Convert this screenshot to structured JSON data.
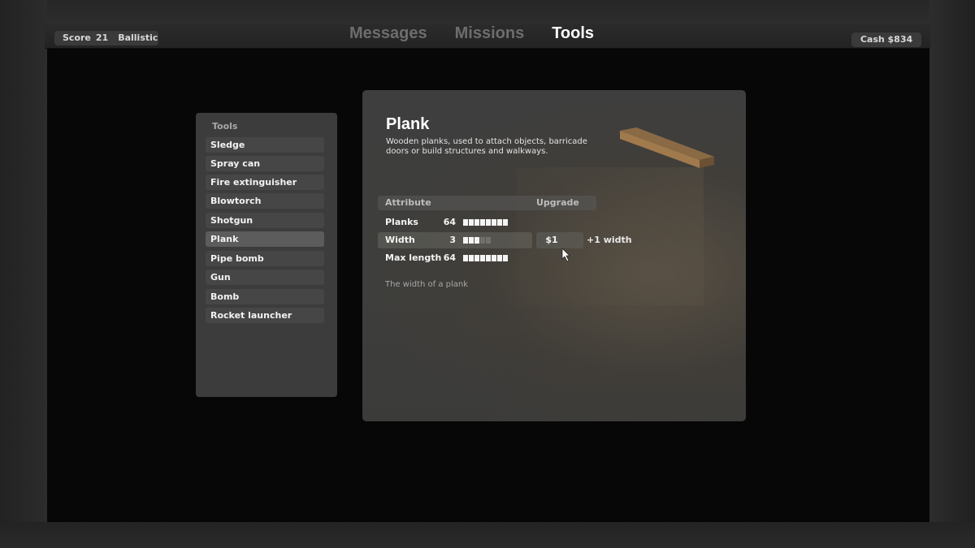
{
  "hud": {
    "score_label": "Score",
    "score_value": "21",
    "mode": "Ballistic",
    "cash": "Cash $834"
  },
  "tabs": [
    {
      "label": "Messages",
      "active": false
    },
    {
      "label": "Missions",
      "active": false
    },
    {
      "label": "Tools",
      "active": true
    }
  ],
  "tool_list": {
    "title": "Tools",
    "items": [
      {
        "label": "Sledge",
        "selected": false
      },
      {
        "label": "Spray can",
        "selected": false
      },
      {
        "label": "Fire extinguisher",
        "selected": false
      },
      {
        "label": "Blowtorch",
        "selected": false
      },
      {
        "label": "Shotgun",
        "selected": false
      },
      {
        "label": "Plank",
        "selected": true
      },
      {
        "label": "Pipe bomb",
        "selected": false
      },
      {
        "label": "Gun",
        "selected": false
      },
      {
        "label": "Bomb",
        "selected": false
      },
      {
        "label": "Rocket launcher",
        "selected": false
      }
    ]
  },
  "detail": {
    "title": "Plank",
    "description": "Wooden planks, used to attach objects, barricade doors or build structures and walkways.",
    "image_icon": "wooden-plank",
    "columns": {
      "attribute": "Attribute",
      "upgrade": "Upgrade"
    },
    "attributes": [
      {
        "name": "Planks",
        "value": "64",
        "level": 8,
        "max_level": 8,
        "upgrade_price": null,
        "upgrade_note": null
      },
      {
        "name": "Width",
        "value": "3",
        "level": 3,
        "max_level": 5,
        "upgrade_price": "$1",
        "upgrade_note": "+1 width"
      },
      {
        "name": "Max length",
        "value": "64",
        "level": 8,
        "max_level": 8,
        "upgrade_price": null,
        "upgrade_note": null
      }
    ],
    "hint": "The width of a plank"
  },
  "colors": {
    "active_tab": "#ffffff",
    "inactive_tab": "#6d6d6d",
    "panel": "#3c3c3c",
    "selected_item": "#5c5c5c"
  }
}
